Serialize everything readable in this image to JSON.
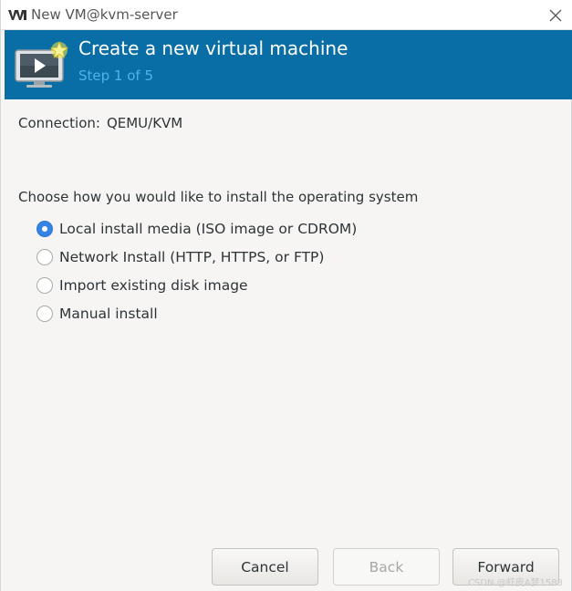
{
  "window": {
    "title": "New VM@kvm-server",
    "app_icon": "virt-manager-logo-icon",
    "close_icon": "close-icon"
  },
  "banner": {
    "title": "Create a new virtual machine",
    "step": "Step 1 of 5",
    "icon": "new-vm-monitor-icon",
    "background_color": "#0a6ea6",
    "step_color": "#4db3e8"
  },
  "connection": {
    "label": "Connection:",
    "value": "QEMU/KVM"
  },
  "install": {
    "question": "Choose how you would like to install the operating system",
    "options": [
      {
        "label": "Local install media (ISO image or CDROM)",
        "selected": true
      },
      {
        "label": "Network Install (HTTP, HTTPS, or FTP)",
        "selected": false
      },
      {
        "label": "Import existing disk image",
        "selected": false
      },
      {
        "label": "Manual install",
        "selected": false
      }
    ]
  },
  "buttons": {
    "cancel": "Cancel",
    "back": "Back",
    "forward": "Forward"
  },
  "watermark": "CSDN @虾皮A梦1588",
  "colors": {
    "accent": "#3584e4"
  }
}
